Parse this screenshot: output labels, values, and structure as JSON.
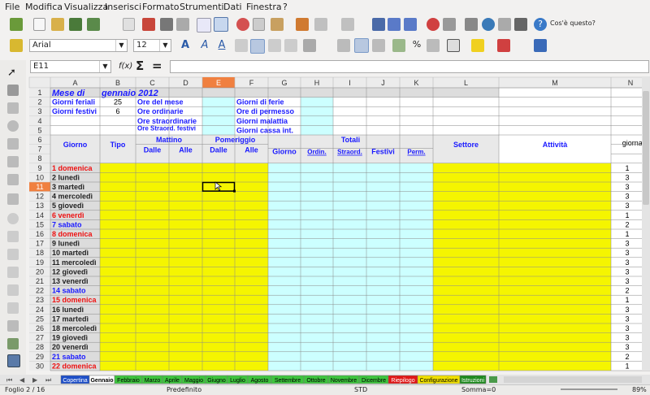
{
  "menu": [
    "File",
    "Modifica",
    "Visualizza",
    "Inserisci",
    "Formato",
    "Strumenti",
    "Dati",
    "Finestra",
    "?"
  ],
  "toolbar": {
    "help_label": "Cos'è questo?",
    "font_name": "Arial",
    "font_size": "12"
  },
  "formula_bar": {
    "cell_ref": "E11",
    "fx": "f(x)",
    "sum": "Σ",
    "equals": "=",
    "content": ""
  },
  "columns": [
    "A",
    "B",
    "C",
    "D",
    "E",
    "F",
    "G",
    "H",
    "I",
    "J",
    "K",
    "L",
    "M",
    "N"
  ],
  "row_numbers": [
    "1",
    "2",
    "3",
    "4",
    "5",
    "6",
    "7",
    "8",
    "9",
    "10",
    "11",
    "12",
    "13",
    "14",
    "15",
    "16",
    "17",
    "18",
    "19",
    "20",
    "21",
    "22",
    "23",
    "24",
    "25",
    "26",
    "27",
    "28",
    "29",
    "30"
  ],
  "header": {
    "title_a": "Mese di",
    "title_b": "gennaio 2012",
    "giorni_feriali_label": "Giorni feriali",
    "giorni_feriali_value": "25",
    "giorni_festivi_label": "Giorni festivi",
    "giorni_festivi_value": "6",
    "ore_mese": "Ore del mese",
    "ore_ordinarie": "Ore ordinarie",
    "ore_straordinarie": "Ore straordinarie",
    "ore_straord_festivi": "Ore Straord. festivi",
    "giorni_ferie": "Giorni di ferie",
    "ore_permesso": "Ore di permesso",
    "giorni_malattia": "Giorni malattia",
    "giorni_cassa": "Giorni cassa int."
  },
  "table_head": {
    "giorno": "Giorno",
    "tipo": "Tipo",
    "mattino": "Mattino",
    "pomeriggio": "Pomeriggio",
    "dalle": "Dalle",
    "alle": "Alle",
    "totali": "Totali",
    "t_giorno": "Giorno",
    "ordin": "Ordin.",
    "straord": "Straord.",
    "festivi": "Festivi",
    "perm": "Perm.",
    "settore": "Settore",
    "attivita": "Attività",
    "giornata": "giornata"
  },
  "days": [
    {
      "label": "1 domenica",
      "type": "sun",
      "n": "1"
    },
    {
      "label": "2 lunedì",
      "type": "wk",
      "n": "3"
    },
    {
      "label": "3 martedì",
      "type": "wk",
      "n": "3"
    },
    {
      "label": "4 mercoledì",
      "type": "wk",
      "n": "3"
    },
    {
      "label": "5 giovedì",
      "type": "wk",
      "n": "3"
    },
    {
      "label": "6 venerdì",
      "type": "sun",
      "n": "1"
    },
    {
      "label": "7 sabato",
      "type": "sat",
      "n": "2"
    },
    {
      "label": "8 domenica",
      "type": "sun",
      "n": "1"
    },
    {
      "label": "9 lunedì",
      "type": "wk",
      "n": "3"
    },
    {
      "label": "10 martedì",
      "type": "wk",
      "n": "3"
    },
    {
      "label": "11 mercoledì",
      "type": "wk",
      "n": "3"
    },
    {
      "label": "12 giovedì",
      "type": "wk",
      "n": "3"
    },
    {
      "label": "13 venerdì",
      "type": "wk",
      "n": "3"
    },
    {
      "label": "14 sabato",
      "type": "sat",
      "n": "2"
    },
    {
      "label": "15 domenica",
      "type": "sun",
      "n": "1"
    },
    {
      "label": "16 lunedì",
      "type": "wk",
      "n": "3"
    },
    {
      "label": "17 martedì",
      "type": "wk",
      "n": "3"
    },
    {
      "label": "18 mercoledì",
      "type": "wk",
      "n": "3"
    },
    {
      "label": "19 giovedì",
      "type": "wk",
      "n": "3"
    },
    {
      "label": "20 venerdì",
      "type": "wk",
      "n": "3"
    },
    {
      "label": "21 sabato",
      "type": "sat",
      "n": "2"
    },
    {
      "label": "22 domenica",
      "type": "sun",
      "n": "1"
    }
  ],
  "sheet_tabs": [
    {
      "name": "Copertina",
      "color": "#1e4fc8",
      "text": "#ffffff"
    },
    {
      "name": "Gennaio",
      "color": "#ffffff",
      "text": "#000000"
    },
    {
      "name": "Febbraio",
      "color": "#3ec43e",
      "text": "#000000"
    },
    {
      "name": "Marzo",
      "color": "#3ec43e",
      "text": "#000000"
    },
    {
      "name": "Aprile",
      "color": "#3ec43e",
      "text": "#000000"
    },
    {
      "name": "Maggio",
      "color": "#3ec43e",
      "text": "#000000"
    },
    {
      "name": "Giugno",
      "color": "#3ec43e",
      "text": "#000000"
    },
    {
      "name": "Luglio",
      "color": "#3ec43e",
      "text": "#000000"
    },
    {
      "name": "Agosto",
      "color": "#3ec43e",
      "text": "#000000"
    },
    {
      "name": "Settembre",
      "color": "#3ec43e",
      "text": "#000000"
    },
    {
      "name": "Ottobre",
      "color": "#3ec43e",
      "text": "#000000"
    },
    {
      "name": "Novembre",
      "color": "#3ec43e",
      "text": "#000000"
    },
    {
      "name": "Dicembre",
      "color": "#3ec43e",
      "text": "#000000"
    },
    {
      "name": "Riepilogo",
      "color": "#e01818",
      "text": "#ffffff"
    },
    {
      "name": "Configurazione",
      "color": "#f0e000",
      "text": "#000000"
    },
    {
      "name": "Istruzioni",
      "color": "#1e8a1e",
      "text": "#ffffff"
    }
  ],
  "status": {
    "sheet": "Foglio 2 / 16",
    "style": "Predefinito",
    "mode": "STD",
    "sum": "Somma=0",
    "zoom": "89%"
  },
  "colors": {
    "blue_text": "#1a1aff",
    "red_text": "#ee1111",
    "yellow": "#f5f500",
    "cyan": "#ccffff",
    "gray_cell": "#dcdcdc",
    "header_bg": "#e9e9e9",
    "selected_col": "#f08040"
  }
}
